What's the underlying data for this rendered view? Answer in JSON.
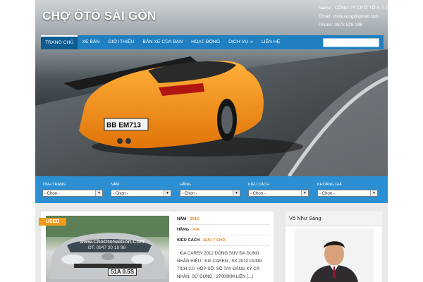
{
  "header": {
    "site_title": "CHỢ ÔTÔ SÀI GÒN",
    "contact_name": "Name : CÔNG TY CP Ô TÔ S À G",
    "contact_email": "Email: choluxung@gmail.com",
    "contact_phone": "Phone: 0978 528 048"
  },
  "nav": {
    "items": [
      {
        "label": "TRANG CHỦ",
        "active": true
      },
      {
        "label": "XE BÁN"
      },
      {
        "label": "GIỚI THIỆU"
      },
      {
        "label": "BÁN XE CỦA BẠN"
      },
      {
        "label": "HOẠT ĐỘNG"
      },
      {
        "label": "DỊCH VỤ",
        "dropdown": "»"
      },
      {
        "label": "LIÊN HỆ"
      }
    ],
    "search_placeholder": ""
  },
  "hero": {
    "plate": "BB EM713"
  },
  "filters": [
    {
      "label": "TÌNH TRẠNG",
      "selected": "- Chọn -"
    },
    {
      "label": "NĂM",
      "selected": "- Chọn -"
    },
    {
      "label": "HÃNG",
      "selected": "- Chọn -"
    },
    {
      "label": "KIỂU CÁCH",
      "selected": "- Chọn -"
    },
    {
      "label": "KHOẢNG GIÁ",
      "selected": "- Chọn -"
    }
  ],
  "listing": {
    "badge": "USED",
    "watermark": "www.ChoOtoSaiGon.Com",
    "watermark_phone": "ĐT: 0947 30 18 98",
    "plate": "51A 0.5S",
    "year_label": "NĂM",
    "year_value": "2012",
    "brand_label": "HÃNG",
    "brand_value": "KIA",
    "style_label": "KIỂU CÁCH",
    "style_value": "SUV 7 CHỖ",
    "description": ": KIA CAREN 2012 DÒNG SUV ĐA DỤNG NHÃN HIỆU : KIA CAREN , SX 2012 DUNG TÍCH 2.0. HỘP SỐ: SỐ TAY ĐĂNG KÝ CÁ NHÂN. SỬ DỤNG : 27000KM LIỀN [...]"
  },
  "sidebar": {
    "name": "Võ Như Sáng"
  },
  "colors": {
    "nav_blue": "#1f7fc0",
    "filter_blue": "#2b8fd1",
    "accent_orange": "#f39a1b"
  }
}
